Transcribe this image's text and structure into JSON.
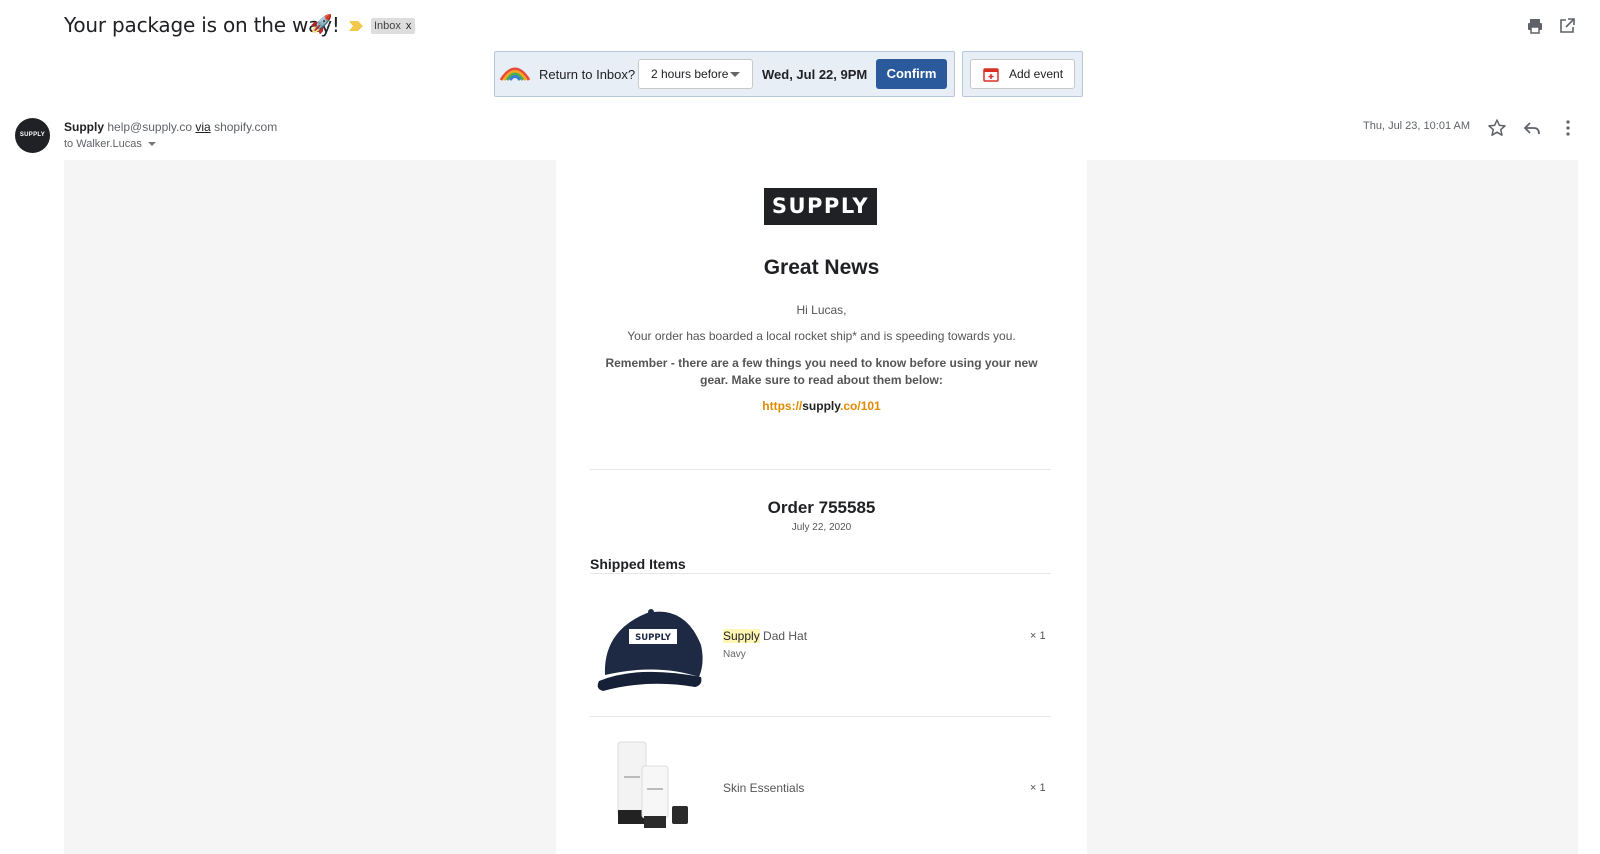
{
  "subject": {
    "title": "Your package is on the way!",
    "emoji": "🚀",
    "label": "Inbox",
    "label_close": "x"
  },
  "snooze": {
    "prompt": "Return to Inbox?",
    "option": "2 hours before",
    "date": "Wed, Jul 22, 9PM",
    "confirm": "Confirm",
    "add_event": "Add event"
  },
  "sender": {
    "avatar_text": "SUPPLY",
    "name": "Supply",
    "email": "help@supply.co",
    "via_word": "via",
    "via_domain": "shopify.com",
    "to_line": "to Walker.Lucas",
    "datetime": "Thu, Jul 23, 10:01 AM"
  },
  "email": {
    "logo": "SUPPLY",
    "headline": "Great News",
    "greeting": "Hi Lucas,",
    "para1": "Your order has boarded a local rocket ship* and is speeding towards you.",
    "para2": "Remember - there are a few things you need to know before using your new gear. Make sure to read about them below:",
    "link_prefix": "https://",
    "link_highlight": "supply",
    "link_suffix": ".co/101",
    "order_title": "Order 755585",
    "order_date": "July 22, 2020",
    "shipped_heading": "Shipped Items",
    "items": [
      {
        "name_highlight": "Supply",
        "name_rest": " Dad Hat",
        "variant": "Navy",
        "qty": "× 1",
        "hat_text": "SUPPLY"
      },
      {
        "name": "Skin Essentials",
        "qty": "× 1"
      }
    ]
  },
  "colors": {
    "confirm": "#2a5a9b",
    "link": "#e08a00",
    "snooze_bg": "#e8eef6"
  }
}
